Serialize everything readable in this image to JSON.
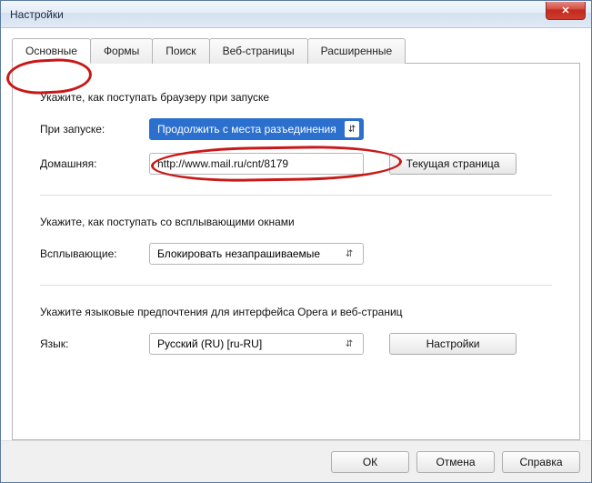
{
  "window": {
    "title": "Настройки"
  },
  "tabs": {
    "basic": "Основные",
    "forms": "Формы",
    "search": "Поиск",
    "webpages": "Веб-страницы",
    "advanced": "Расширенные"
  },
  "startup": {
    "heading": "Укажите, как поступать браузеру при запуске",
    "on_start_label": "При запуске:",
    "on_start_value": "Продолжить с места разъединения",
    "home_label": "Домашняя:",
    "home_value": "http://www.mail.ru/cnt/8179",
    "current_page_btn": "Текущая страница"
  },
  "popups": {
    "heading": "Укажите, как поступать со всплывающими окнами",
    "label": "Всплывающие:",
    "value": "Блокировать незапрашиваемые"
  },
  "language": {
    "heading": "Укажите языковые предпочтения для интерфейса Opera и веб-страниц",
    "label": "Язык:",
    "value": "Русский (RU) [ru-RU]",
    "settings_btn": "Настройки"
  },
  "footer": {
    "ok": "ОК",
    "cancel": "Отмена",
    "help": "Справка"
  }
}
